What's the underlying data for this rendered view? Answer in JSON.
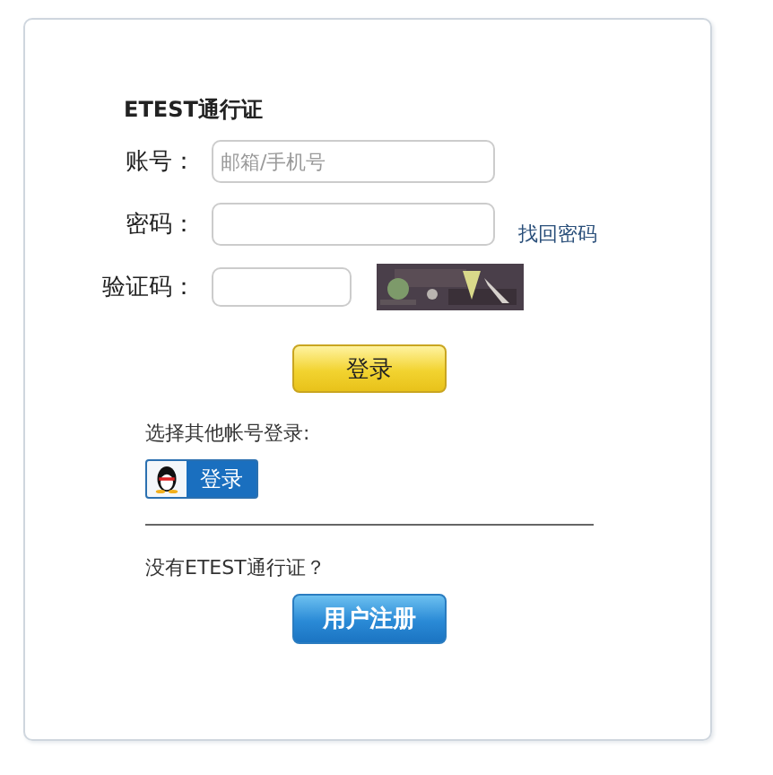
{
  "title": "ETEST通行证",
  "fields": [
    {
      "kind": "text",
      "label": "账号：",
      "placeholder": "邮箱/手机号"
    },
    {
      "kind": "password",
      "label": "密码：",
      "link": "找回密码"
    },
    {
      "kind": "captcha",
      "label": "验证码："
    }
  ],
  "login_button": "登录",
  "other_login": {
    "prompt": "选择其他帐号登录:",
    "button": "登录"
  },
  "register": {
    "prompt": "没有ETEST通行证？",
    "button": "用户注册"
  }
}
